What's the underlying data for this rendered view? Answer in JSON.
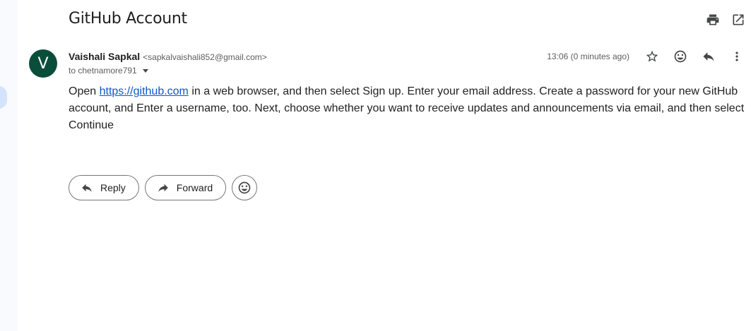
{
  "email": {
    "subject": "GitHub Account",
    "sender": {
      "initial": "V",
      "name": "Vaishali Sapkal",
      "email": "<sapkalvaishali852@gmail.com>"
    },
    "recipient": "to chetnamore791",
    "timestamp": "13:06 (0 minutes ago)",
    "body": {
      "before_link": "Open ",
      "link_text": "https://github.com",
      "after_link": " in a web browser, and then select Sign up. Enter your email address. Create a password for your new GitHub account, and Enter a username, too. Next, choose whether you want to receive updates and announcements via email, and then select Continue"
    }
  },
  "actions": {
    "reply_label": "Reply",
    "forward_label": "Forward"
  },
  "icons": {
    "top": [
      "print-icon",
      "open-in-new-icon"
    ],
    "meta": [
      "star-icon",
      "emoji-icon",
      "reply-icon",
      "more-vert-icon"
    ]
  },
  "colors": {
    "avatar_bg": "#0b4d3b",
    "link": "#0b57d0",
    "accent_pill": "#d3e3fd"
  }
}
